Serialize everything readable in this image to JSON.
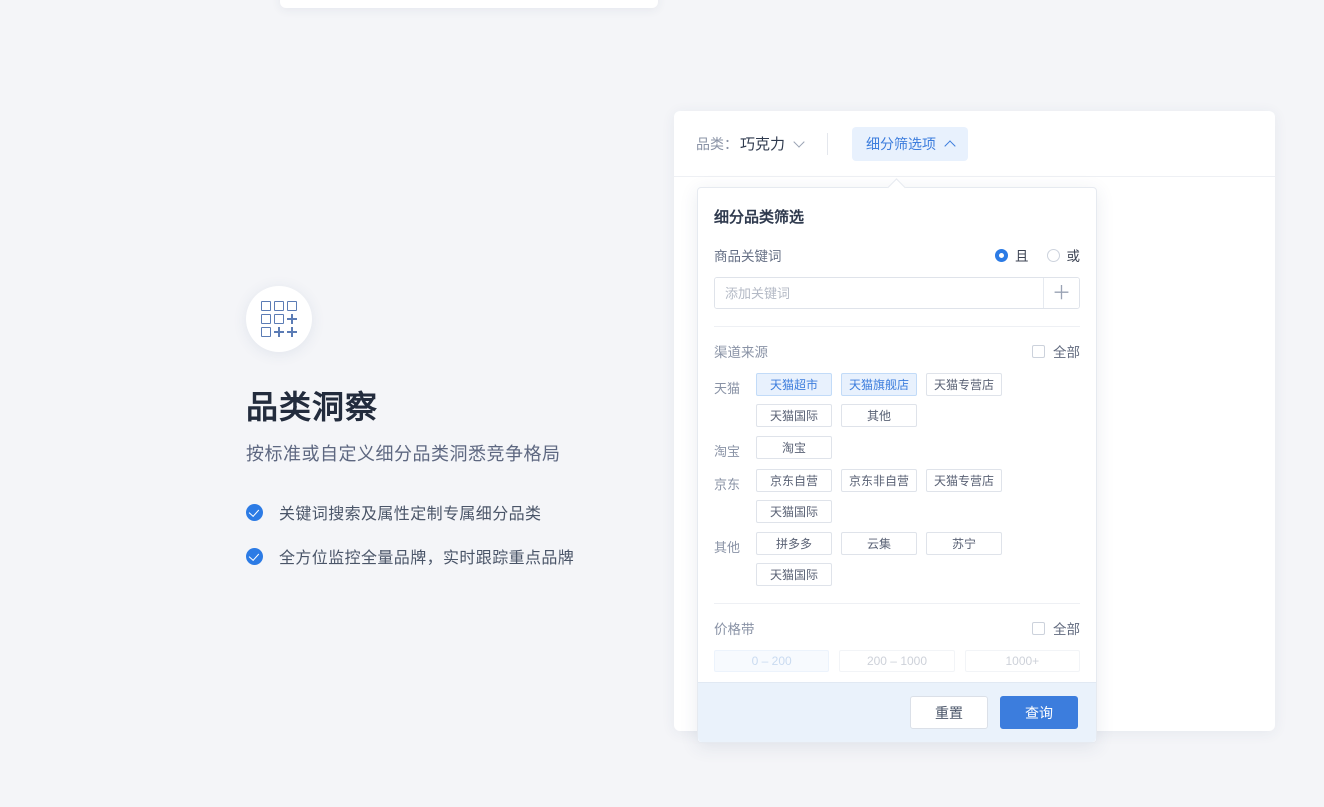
{
  "theme": {
    "page_bg": "#f4f5f8",
    "accent": "#3c7ddd",
    "accent_soft_bg": "#e8f1fd",
    "check_blue": "#2c7be5",
    "footer_bg": "#eaf2fb",
    "title_color": "#232c3d"
  },
  "hero": {
    "icon": "category-grid-icon",
    "title": "品类洞察",
    "subtitle": "按标准或自定义细分品类洞悉竞争格局",
    "bullets": [
      {
        "icon": "check-circle-icon",
        "text": "关键词搜索及属性定制专属细分品类"
      },
      {
        "icon": "check-circle-icon",
        "text": "全方位监控全量品牌，实时跟踪重点品牌"
      }
    ]
  },
  "toolbar": {
    "category_label": "品类：",
    "category_value": "巧克力",
    "category_caret": "chevron-down-icon",
    "filter_toggle_label": "细分筛选项",
    "filter_toggle_caret": "chevron-up-icon"
  },
  "popup": {
    "title": "细分品类筛选",
    "keyword": {
      "label": "商品关键词",
      "logic_options": [
        {
          "label": "且",
          "selected": true
        },
        {
          "label": "或",
          "selected": false
        }
      ],
      "input_value": "",
      "input_placeholder": "添加关键词",
      "add_button_icon": "plus-icon"
    },
    "channel": {
      "label": "渠道来源",
      "all_label": "全部",
      "all_checked": false,
      "groups": [
        {
          "label": "天猫",
          "tags": [
            {
              "label": "天猫超市",
              "selected": true
            },
            {
              "label": "天猫旗舰店",
              "selected": true
            },
            {
              "label": "天猫专营店",
              "selected": false
            },
            {
              "label": "天猫国际",
              "selected": false
            },
            {
              "label": "其他",
              "selected": false
            }
          ]
        },
        {
          "label": "淘宝",
          "tags": [
            {
              "label": "淘宝",
              "selected": false
            }
          ]
        },
        {
          "label": "京东",
          "tags": [
            {
              "label": "京东自营",
              "selected": false
            },
            {
              "label": "京东非自营",
              "selected": false
            },
            {
              "label": "天猫专营店",
              "selected": false
            },
            {
              "label": "天猫国际",
              "selected": false
            }
          ]
        },
        {
          "label": "其他",
          "tags": [
            {
              "label": "拼多多",
              "selected": false
            },
            {
              "label": "云集",
              "selected": false
            },
            {
              "label": "苏宁",
              "selected": false
            },
            {
              "label": "天猫国际",
              "selected": false
            }
          ]
        }
      ]
    },
    "price": {
      "label": "价格带",
      "all_label": "全部",
      "all_checked": false,
      "tags": [
        {
          "label": "0 – 200",
          "selected": true
        },
        {
          "label": "200 – 1000",
          "selected": false
        },
        {
          "label": "1000+",
          "selected": false
        }
      ]
    },
    "footer": {
      "reset_label": "重置",
      "submit_label": "查询"
    }
  }
}
